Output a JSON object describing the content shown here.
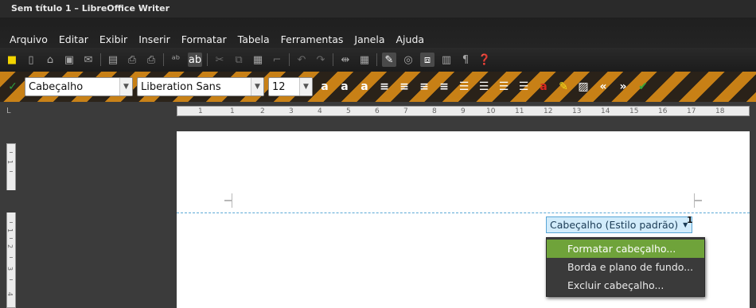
{
  "window": {
    "title": "Sem título 1 – LibreOffice Writer"
  },
  "menu": [
    {
      "label": "Arquivo"
    },
    {
      "label": "Editar"
    },
    {
      "label": "Exibir"
    },
    {
      "label": "Inserir"
    },
    {
      "label": "Formatar"
    },
    {
      "label": "Tabela"
    },
    {
      "label": "Ferramentas"
    },
    {
      "label": "Janela"
    },
    {
      "label": "Ajuda"
    }
  ],
  "formatting": {
    "paragraph_style": "Cabeçalho",
    "font_name": "Liberation Sans",
    "font_size": "12"
  },
  "ruler": {
    "labels": [
      "1",
      "1",
      "2",
      "3",
      "4",
      "5",
      "6",
      "7",
      "8",
      "9",
      "10",
      "11",
      "12",
      "13",
      "14",
      "15",
      "16",
      "17",
      "18"
    ],
    "corner": "L"
  },
  "vertical_ruler": {
    "labels": [
      "1",
      "1",
      "2",
      "3",
      "4"
    ]
  },
  "header": {
    "button_label": "Cabeçalho (Estilo padrão)",
    "page_number": "1"
  },
  "context_menu": [
    {
      "label": "Formatar cabeçalho...",
      "active": true
    },
    {
      "label": "Borda e plano de fundo...",
      "active": false
    },
    {
      "label": "Excluir cabeçalho...",
      "active": false
    }
  ],
  "colors": {
    "menu_highlight": "#6fa33a",
    "header_button_bg": "#d2ecfb",
    "header_line": "#5aa8d6"
  }
}
